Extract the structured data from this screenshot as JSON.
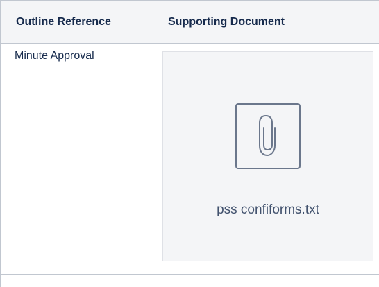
{
  "table": {
    "headers": [
      "Outline Reference",
      "Supporting Document"
    ],
    "rows": [
      {
        "reference": "Minute Approval",
        "attachment": {
          "file_name": "pss confiforms.txt",
          "icon": "paperclip-icon"
        }
      }
    ]
  }
}
